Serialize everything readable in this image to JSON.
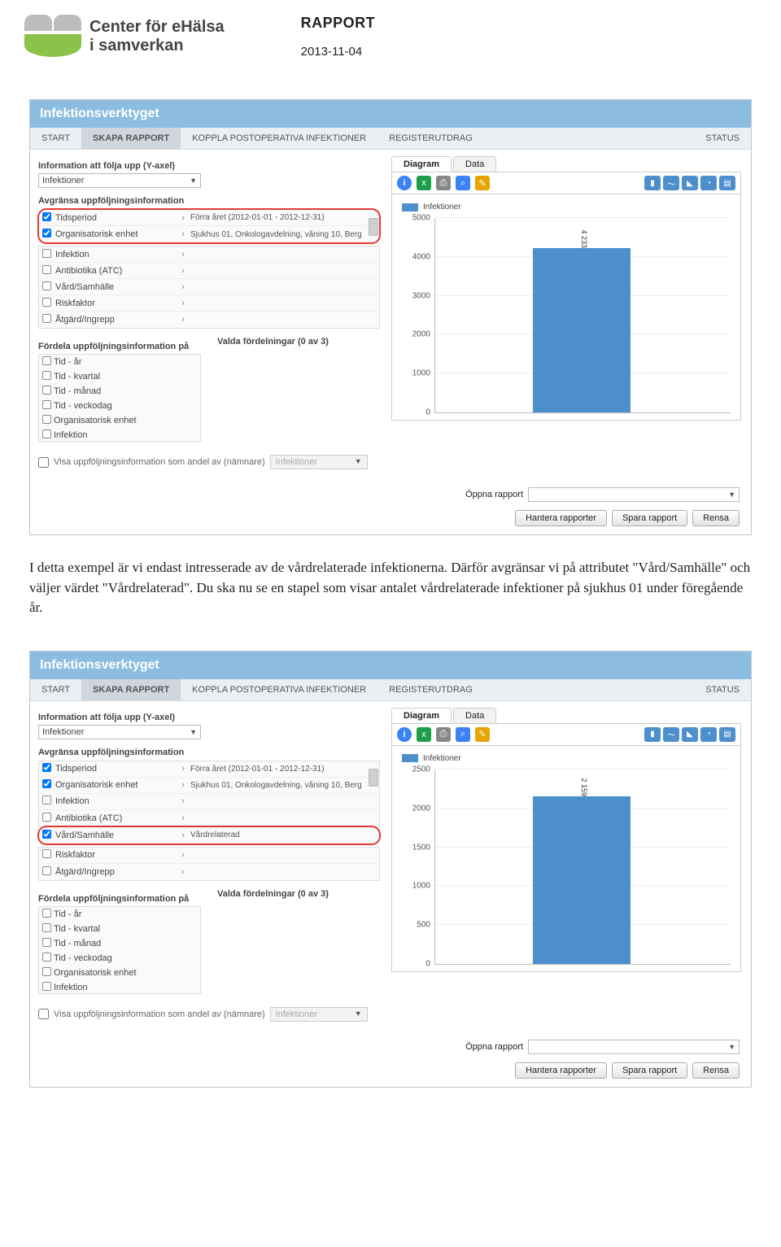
{
  "doc": {
    "logo_line1": "Center för eHälsa",
    "logo_line2": "i samverkan",
    "rapport": "RAPPORT",
    "date": "2013-11-04"
  },
  "body_paragraph": "I detta exempel är vi endast intresserade av de vårdrelaterade infektionerna. Därför avgränsar vi på attributet \"Vård/Samhälle\" och väljer värdet \"Vårdrelaterad\". Du ska nu se en stapel som visar antalet vårdrelaterade infektioner på sjukhus 01 under föregående år.",
  "app": {
    "title": "Infektionsverktyget",
    "nav": {
      "start": "START",
      "skapa": "SKAPA RAPPORT",
      "koppla": "KOPPLA POSTOPERATIVA INFEKTIONER",
      "register": "REGISTERUTDRAG",
      "status": "STATUS"
    },
    "tabs": {
      "diagram": "Diagram",
      "data": "Data"
    },
    "left": {
      "info_label": "Information att följa upp (Y-axel)",
      "info_value": "Infektioner",
      "avg_label": "Avgränsa uppföljningsinformation",
      "filters": {
        "tidsperiod": "Tidsperiod",
        "orgenhet": "Organisatorisk enhet",
        "infektion": "Infektion",
        "antibiotika": "Antibiotika (ATC)",
        "vardsamhalle": "Vård/Samhälle",
        "riskfaktor": "Riskfaktor",
        "atgard": "Åtgärd/Ingrepp"
      },
      "filter_values": {
        "tidsperiod": "Förra året (2012-01-01 - 2012-12-31)",
        "orgenhet": "Sjukhus 01, Onkologavdelning, våning 10, Berg",
        "vardsamhalle": "Vårdrelaterad"
      },
      "fordela_label": "Fördela uppföljningsinformation på",
      "valda_label": "Valda fördelningar (0 av 3)",
      "fordela_items": {
        "tid_ar": "Tid - år",
        "tid_kvartal": "Tid - kvartal",
        "tid_manad": "Tid - månad",
        "tid_veckodag": "Tid - veckodag",
        "orgenhet": "Organisatorisk enhet",
        "infektion": "Infektion"
      },
      "andel_label": "Visa uppföljningsinformation som andel av (nämnare)",
      "andel_value": "Infektioner"
    },
    "legend": "Infektioner",
    "footer": {
      "oppna": "Öppna rapport",
      "hantera": "Hantera rapporter",
      "spara": "Spara rapport",
      "rensa": "Rensa"
    }
  },
  "chart_data": [
    {
      "type": "bar",
      "categories": [
        ""
      ],
      "values": [
        4233
      ],
      "value_label": "4 233",
      "title": "",
      "xlabel": "",
      "ylabel": "",
      "ylim": [
        0,
        5000
      ],
      "yticks": [
        0,
        1000,
        2000,
        3000,
        4000,
        5000
      ],
      "legend": [
        "Infektioner"
      ]
    },
    {
      "type": "bar",
      "categories": [
        ""
      ],
      "values": [
        2159
      ],
      "value_label": "2 159",
      "title": "",
      "xlabel": "",
      "ylabel": "",
      "ylim": [
        0,
        2500
      ],
      "yticks": [
        0,
        500,
        1000,
        1500,
        2000,
        2500
      ],
      "legend": [
        "Infektioner"
      ]
    }
  ]
}
